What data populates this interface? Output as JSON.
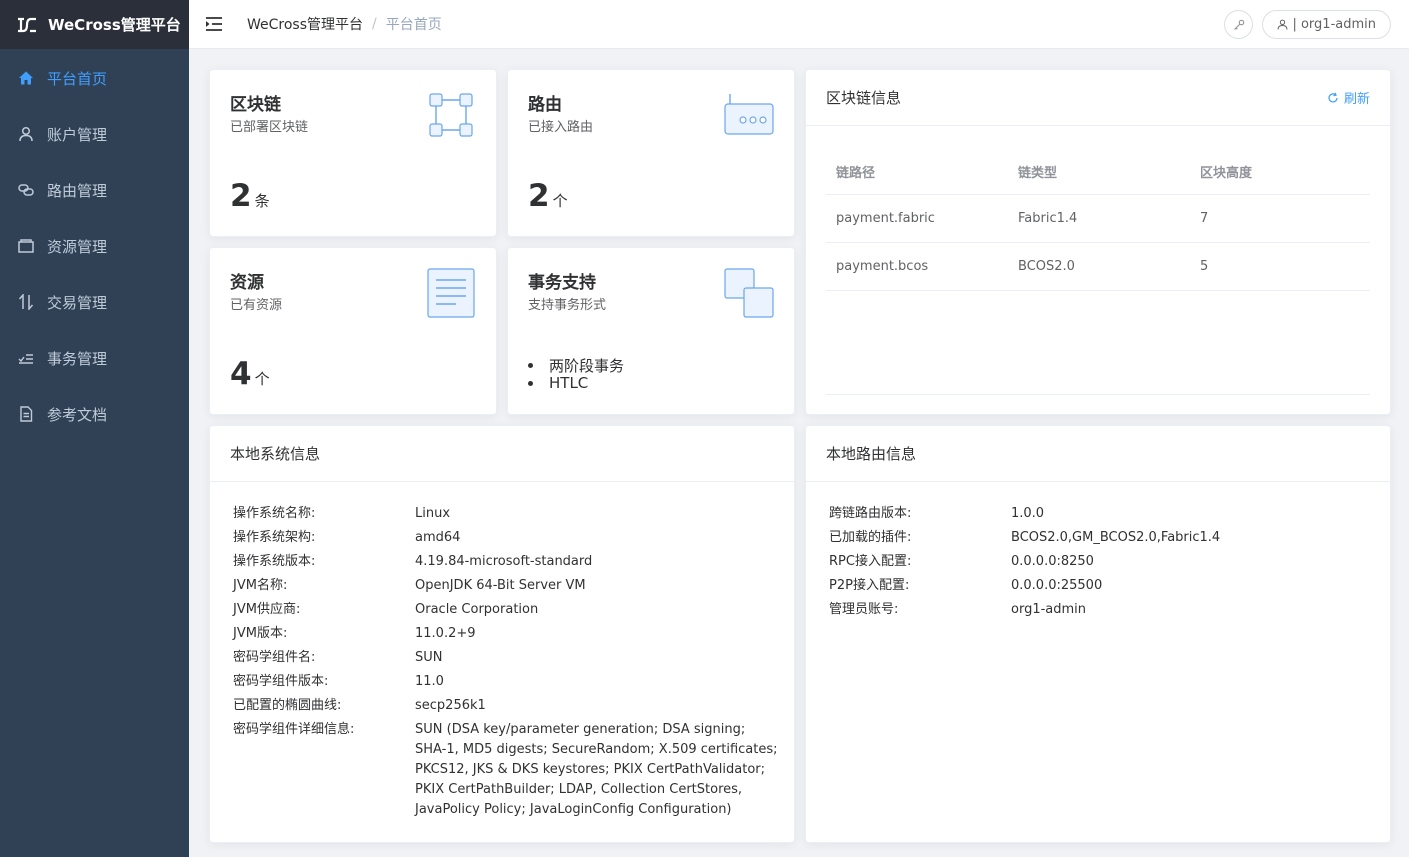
{
  "app": {
    "logo_text": "WeCross管理平台"
  },
  "sidebar": {
    "items": [
      {
        "label": "平台首页",
        "icon": "home-icon",
        "active": true
      },
      {
        "label": "账户管理",
        "icon": "user-icon",
        "active": false
      },
      {
        "label": "路由管理",
        "icon": "link-icon",
        "active": false
      },
      {
        "label": "资源管理",
        "icon": "wallet-icon",
        "active": false
      },
      {
        "label": "交易管理",
        "icon": "transfer-icon",
        "active": false
      },
      {
        "label": "事务管理",
        "icon": "list-check-icon",
        "active": false
      },
      {
        "label": "参考文档",
        "icon": "document-icon",
        "active": false
      }
    ]
  },
  "header": {
    "breadcrumb": [
      "WeCross管理平台",
      "平台首页"
    ],
    "separator": "/",
    "user_label": "| org1-admin"
  },
  "stats": {
    "chain": {
      "title": "区块链",
      "subtitle": "已部署区块链",
      "value": "2",
      "unit": "条"
    },
    "router": {
      "title": "路由",
      "subtitle": "已接入路由",
      "value": "2",
      "unit": "个"
    },
    "resource": {
      "title": "资源",
      "subtitle": "已有资源",
      "value": "4",
      "unit": "个"
    },
    "transaction": {
      "title": "事务支持",
      "subtitle": "支持事务形式",
      "items": [
        "两阶段事务",
        "HTLC"
      ]
    }
  },
  "chain_info": {
    "title": "区块链信息",
    "refresh_label": "刷新",
    "columns": [
      "链路径",
      "链类型",
      "区块高度"
    ],
    "rows": [
      [
        "payment.fabric",
        "Fabric1.4",
        "7"
      ],
      [
        "payment.bcos",
        "BCOS2.0",
        "5"
      ]
    ]
  },
  "system_info": {
    "title": "本地系统信息",
    "rows": [
      {
        "label": "操作系统名称:",
        "value": "Linux"
      },
      {
        "label": "操作系统架构:",
        "value": "amd64"
      },
      {
        "label": "操作系统版本:",
        "value": "4.19.84-microsoft-standard"
      },
      {
        "label": "JVM名称:",
        "value": "OpenJDK 64-Bit Server VM"
      },
      {
        "label": "JVM供应商:",
        "value": "Oracle Corporation"
      },
      {
        "label": "JVM版本:",
        "value": "11.0.2+9"
      },
      {
        "label": "密码学组件名:",
        "value": "SUN"
      },
      {
        "label": "密码学组件版本:",
        "value": "11.0"
      },
      {
        "label": "已配置的椭圆曲线:",
        "value": "secp256k1"
      },
      {
        "label": "密码学组件详细信息:",
        "value": "SUN (DSA key/parameter generation; DSA signing; SHA-1, MD5 digests; SecureRandom; X.509 certificates; PKCS12, JKS & DKS keystores; PKIX CertPathValidator; PKIX CertPathBuilder; LDAP, Collection CertStores, JavaPolicy Policy; JavaLoginConfig Configuration)"
      }
    ]
  },
  "router_info": {
    "title": "本地路由信息",
    "rows": [
      {
        "label": "跨链路由版本:",
        "value": "1.0.0"
      },
      {
        "label": "已加载的插件:",
        "value": "BCOS2.0,GM_BCOS2.0,Fabric1.4"
      },
      {
        "label": "RPC接入配置:",
        "value": "0.0.0.0:8250"
      },
      {
        "label": "P2P接入配置:",
        "value": "0.0.0.0:25500"
      },
      {
        "label": "管理员账号:",
        "value": "org1-admin"
      }
    ]
  },
  "colors": {
    "accent": "#409eff",
    "sidebar_bg": "#304156",
    "logo_bg": "#2b2f3a",
    "menu_text": "#bfcbd9"
  }
}
